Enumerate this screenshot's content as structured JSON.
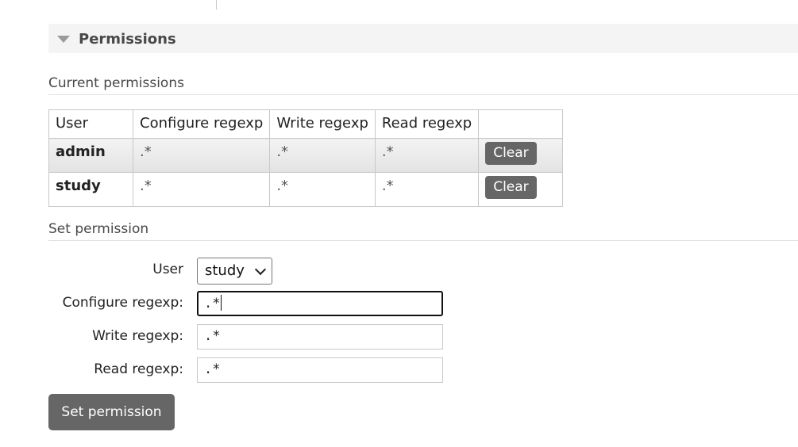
{
  "section": {
    "title": "Permissions"
  },
  "current": {
    "heading": "Current permissions",
    "columns": [
      "User",
      "Configure regexp",
      "Write regexp",
      "Read regexp",
      ""
    ],
    "rows": [
      {
        "user": "admin",
        "configure": ".*",
        "write": ".*",
        "read": ".*",
        "action": "Clear"
      },
      {
        "user": "study",
        "configure": ".*",
        "write": ".*",
        "read": ".*",
        "action": "Clear"
      }
    ]
  },
  "set": {
    "heading": "Set permission",
    "user_label": "User",
    "user_selected": "study",
    "configure_label": "Configure regexp:",
    "configure_value": ".*",
    "write_label": "Write regexp:",
    "write_value": ".*",
    "read_label": "Read regexp:",
    "read_value": ".*",
    "submit_label": "Set permission"
  },
  "colors": {
    "button_bg": "#666666",
    "header_bg": "#f4f4f4"
  }
}
